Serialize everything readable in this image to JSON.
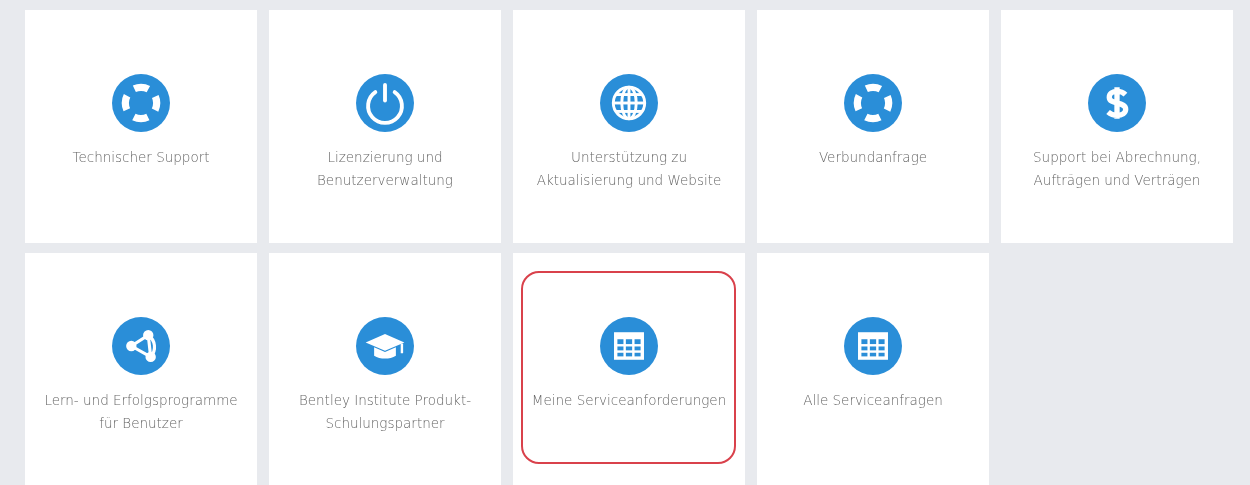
{
  "tiles": [
    {
      "kind": "lifebuoy",
      "label": "Technischer Support",
      "highlighted": false
    },
    {
      "kind": "power",
      "label": "Lizenzierung und Benutzerverwaltung",
      "highlighted": false
    },
    {
      "kind": "globe",
      "label": "Unterstützung zu Aktualisierung und Website",
      "highlighted": false
    },
    {
      "kind": "lifebuoy",
      "label": "Verbundanfrage",
      "highlighted": false
    },
    {
      "kind": "dollar",
      "label": "Support bei Abrechnung, Aufträgen und Verträgen",
      "highlighted": false
    },
    {
      "kind": "network",
      "label": "Lern- und Erfolgsprogramme für Benutzer",
      "highlighted": false
    },
    {
      "kind": "cap",
      "label": "Bentley Institute Produkt-Schulungspartner",
      "highlighted": false
    },
    {
      "kind": "table",
      "label": "Meine Serviceanforderungen",
      "highlighted": true
    },
    {
      "kind": "table",
      "label": "Alle Serviceanfragen",
      "highlighted": false
    }
  ]
}
